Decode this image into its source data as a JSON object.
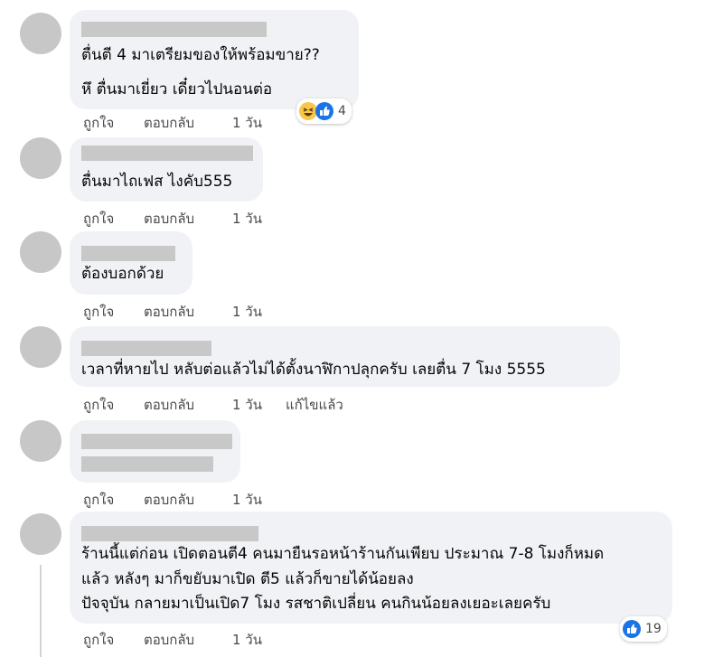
{
  "actions": {
    "like": "ถูกใจ",
    "reply": "ตอบกลับ",
    "time": "1 วัน",
    "edited": "แก้ไขแล้ว"
  },
  "comments": [
    {
      "lines": [
        "ตื่นตี 4 มาเตรียมของให้พร้อมขาย??",
        "หึ ตื่นมาเยี่ยว เดี๋ยวไปนอนต่อ"
      ],
      "reaction_count": "4",
      "reactions": [
        "haha-icon",
        "like-icon"
      ]
    },
    {
      "lines": [
        "ตื่นมาไถเฟส ไงคับ555"
      ]
    },
    {
      "lines": [
        "ต้องบอกด้วย"
      ]
    },
    {
      "lines": [
        "เวลาที่หายไป หลับต่อแล้วไม่ได้ตั้งนาฬิกาปลุกครับ เลยตื่น 7 โมง 5555"
      ],
      "edited": true
    },
    {
      "lines": []
    },
    {
      "lines": [
        "ร้านนี้แต่ก่อน เปิดตอนตี4 คนมายืนรอหน้าร้านกันเพียบ ประมาณ 7-8 โมงก็หมด",
        "แล้ว หลังๆ มาก็ขยับมาเปิด ตี5 แล้วก็ขายได้น้อยลง",
        "ปัจจุบัน กลายมาเป็นเปิด7 โมง รสชาติเปลี่ยน คนกินน้อยลงเยอะเลยครับ"
      ],
      "reaction_count": "19",
      "reactions": [
        "like-icon"
      ]
    }
  ]
}
